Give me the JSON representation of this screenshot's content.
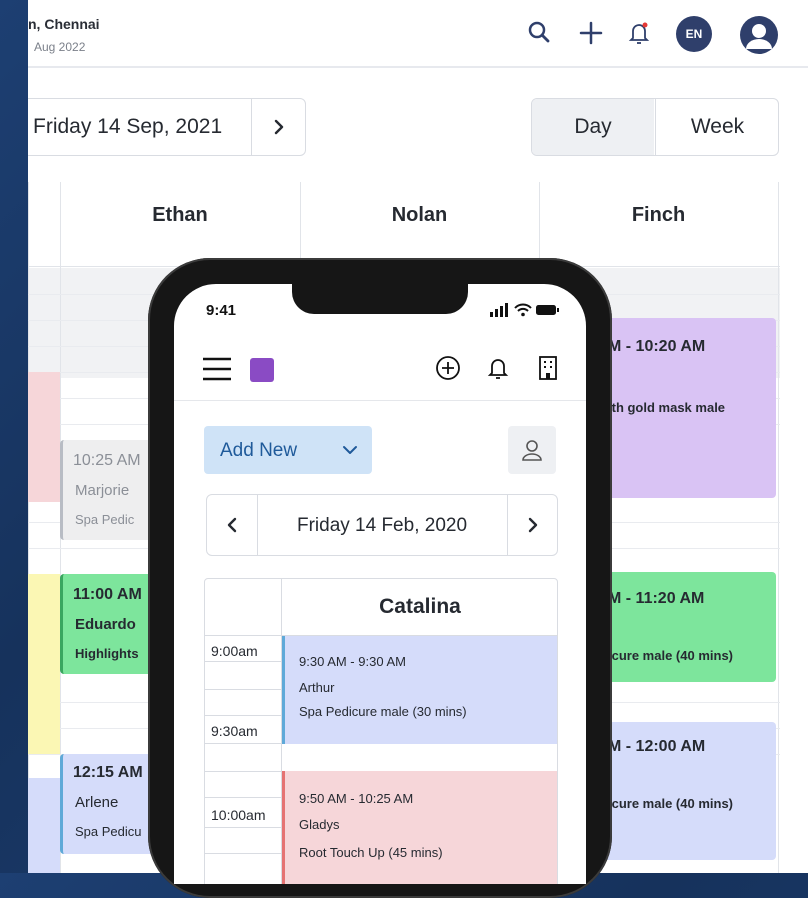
{
  "desktop": {
    "location_name": "n, Chennai",
    "location_date": "Aug 2022",
    "language_badge": "EN",
    "date_label": "Friday 14 Sep, 2021",
    "view_toggle": {
      "day": "Day",
      "week": "Week"
    },
    "staff": [
      "Ethan",
      "Nolan",
      "Finch"
    ],
    "events": {
      "e1": {
        "time": "10:25 AM",
        "name": "Marjorie",
        "service": "Spa Pedic"
      },
      "e2": {
        "time": "11:00 AM",
        "name": "Eduardo",
        "service": "Highlights"
      },
      "e3": {
        "time": "12:15 AM",
        "name": "Arlene",
        "service": "Spa Pedicu"
      },
      "f1": {
        "time": "M - 10:20 AM",
        "service": "ith gold mask male",
        "extra": ")"
      },
      "f2": {
        "time": "M - 11:20 AM",
        "service": "icure male (40 mins)"
      },
      "f3": {
        "time": "M - 12:00 AM",
        "service": "icure male (40 mins)"
      }
    },
    "colors": {
      "pink": "#f6d6d9",
      "yellow": "#fbf7b4",
      "green": "#7de59c",
      "lavender": "#d9c3f4",
      "blue": "#d5dcfa",
      "gray": "#eeeeef"
    }
  },
  "phone": {
    "time": "9:41",
    "add_new": "Add New",
    "date_label": "Friday 14 Feb, 2020",
    "staff": "Catalina",
    "times": [
      "9:00am",
      "9:30am",
      "10:00am"
    ],
    "events": [
      {
        "time": "9:30 AM - 9:30 AM",
        "name": "Arthur",
        "service": "Spa Pedicure male (30 mins)"
      },
      {
        "time": "9:50 AM - 10:25 AM",
        "name": "Gladys",
        "service": "Root Touch Up (45 mins)"
      }
    ]
  }
}
